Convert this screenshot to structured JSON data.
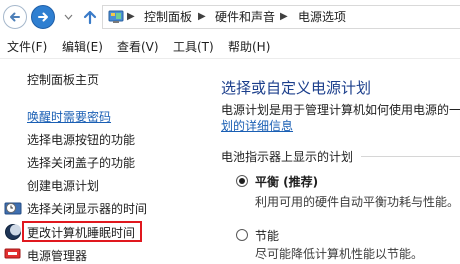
{
  "address_bar": {
    "breadcrumbs": [
      "控制面板",
      "硬件和声音",
      "电源选项"
    ]
  },
  "menu": {
    "items": [
      "文件(F)",
      "编辑(E)",
      "查看(V)",
      "工具(T)",
      "帮助(H)"
    ]
  },
  "sidebar": {
    "home": "控制面板主页",
    "links": [
      "唤醒时需要密码",
      "选择电源按钮的功能",
      "选择关闭盖子的功能",
      "创建电源计划",
      "选择关闭显示器的时间",
      "更改计算机睡眠时间",
      "电源管理器"
    ],
    "highlight_color": "#e0181e"
  },
  "main": {
    "title": "选择或自定义电源计划",
    "description": "电源计划是用于管理计算机如何使用电源的一",
    "link": "划的详细信息",
    "group_label": "电池指示器上显示的计划",
    "plans": [
      {
        "name": "平衡 (推荐)",
        "description": "利用可用的硬件自动平衡功耗与性能。",
        "selected": true
      },
      {
        "name": "节能",
        "description": "尽可能降低计算机性能以节能。",
        "selected": false
      }
    ]
  },
  "colors": {
    "title_blue": "#1c3f8c",
    "link_blue": "#1a5fb4",
    "nav_blue": "#2f7fd1"
  }
}
